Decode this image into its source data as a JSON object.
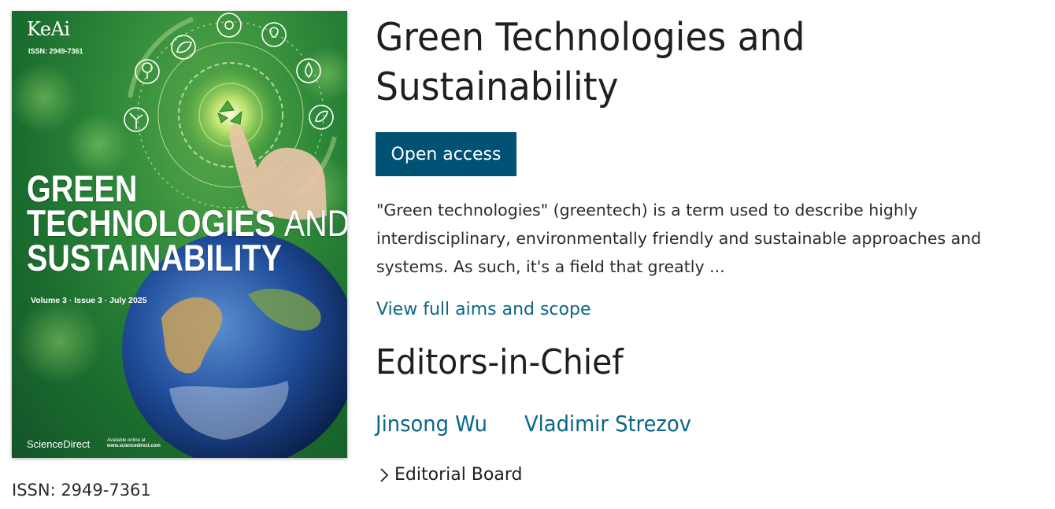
{
  "cover": {
    "brand": "KeAi",
    "issn": "ISSN: 2949-7361",
    "title_lines": [
      "GREEN",
      "TECHNOLOGIES",
      "AND",
      "SUSTAINABILITY"
    ],
    "volume_line": "Volume 3 · Issue 3 · July 2025",
    "publisher": "ScienceDirect",
    "available_line1": "Available online at",
    "available_line2": "www.sciencedirect.com"
  },
  "issn_label": "ISSN: 2949-7361",
  "journal": {
    "title": "Green Technologies and Sustainability",
    "open_access_label": "Open access",
    "description": "\"Green technologies\" (greentech) is a term used to describe highly interdisciplinary, environmentally friendly and sustainable approaches and systems. As such, it's a field that greatly ...",
    "aims_link": "View full aims and scope"
  },
  "editors": {
    "heading": "Editors-in-Chief",
    "names": [
      "Jinsong Wu",
      "Vladimir Strezov"
    ],
    "board_label": "Editorial Board"
  },
  "colors": {
    "button_bg": "#005274",
    "link": "#0a6685",
    "cover_green": "#1f7a32"
  },
  "icons": [
    "leaf-icon",
    "sun-icon",
    "lightbulb-icon",
    "tree-icon",
    "water-drop-icon",
    "wind-turbine-icon",
    "recycle-icon",
    "chevron-right-icon"
  ]
}
